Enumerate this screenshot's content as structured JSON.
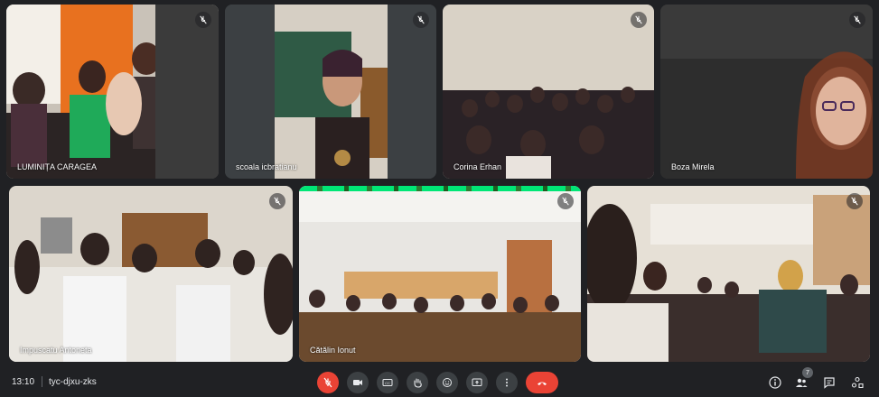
{
  "participants": [
    {
      "name": "LUMINIȚA CARAGEA",
      "muted": true
    },
    {
      "name": "scoala icbratianu",
      "muted": true
    },
    {
      "name": "Corina Erhan",
      "muted": true
    },
    {
      "name": "Boza Mirela",
      "muted": true
    },
    {
      "name": "Impuscatu Antoneta",
      "muted": true
    },
    {
      "name": "Cătălin Ionut",
      "muted": true,
      "speaking": true
    },
    {
      "name": "",
      "muted": true
    }
  ],
  "bottom_bar": {
    "time": "13:10",
    "separator": "|",
    "meeting_code": "tyc-djxu-zks",
    "people_count": "7"
  },
  "controls": [
    {
      "icon": "mic-off-icon"
    },
    {
      "icon": "camera-icon"
    },
    {
      "icon": "captions-icon"
    },
    {
      "icon": "raise-hand-icon"
    },
    {
      "icon": "emoji-icon"
    },
    {
      "icon": "present-screen-icon"
    },
    {
      "icon": "more-options-icon"
    },
    {
      "icon": "end-call-icon"
    }
  ],
  "colors": {
    "background": "#202124",
    "tile": "#3c4043",
    "control": "#3c4043",
    "danger": "#ea4335",
    "speaking": "#00e676"
  }
}
